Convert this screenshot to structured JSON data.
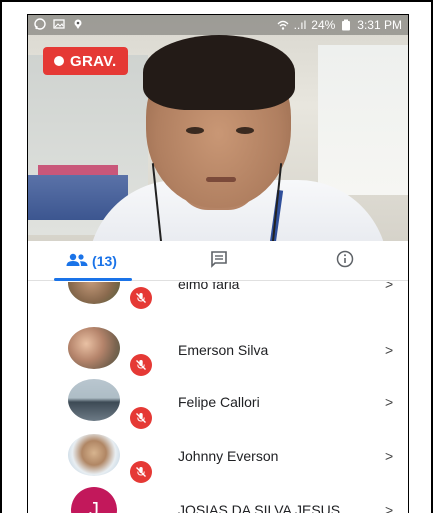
{
  "status_bar": {
    "signal_text": "..ıl",
    "battery_percent": "24%",
    "time": "3:31 PM"
  },
  "recording": {
    "label": "GRAV."
  },
  "tabs": {
    "people_count": "(13)",
    "active": "people"
  },
  "participants": [
    {
      "name": "elmo faria",
      "muted": true,
      "avatar": "photo"
    },
    {
      "name": "Emerson Silva",
      "muted": true,
      "avatar": "photo"
    },
    {
      "name": "Felipe Callori",
      "muted": true,
      "avatar": "photo"
    },
    {
      "name": "Johnny Everson",
      "muted": true,
      "avatar": "photo"
    },
    {
      "name": "JOSIAS DA SILVA JESUS",
      "muted": true,
      "avatar": "letter",
      "letter": "J"
    }
  ],
  "chevron": ">",
  "colors": {
    "accent": "#1a73e8",
    "record_red": "#e53935",
    "avatar_letter_bg": "#c2185b"
  }
}
